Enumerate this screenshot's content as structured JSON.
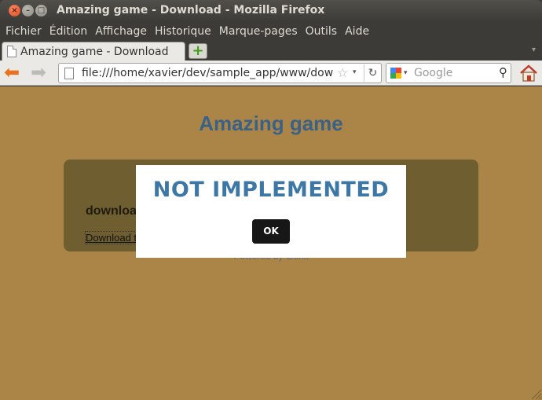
{
  "window": {
    "title": "Amazing game - Download - Mozilla Firefox",
    "close_glyph": "×",
    "minimize_glyph": "–",
    "maximize_glyph": "□"
  },
  "menu": [
    "Fichier",
    "Édition",
    "Affichage",
    "Historique",
    "Marque-pages",
    "Outils",
    "Aide"
  ],
  "tabs": [
    {
      "label": "Amazing game - Download"
    }
  ],
  "toolbar": {
    "new_tab_glyph": "+",
    "back_glyph": "⬅",
    "forward_glyph": "➡",
    "url": "file:///home/xavier/dev/sample_app/www/download.html",
    "bookmark_star": "☆",
    "dropdown_glyph": "▾",
    "reload_glyph": "↻",
    "search_placeholder": "Google",
    "search_glyph": "⚲"
  },
  "page": {
    "title": "Amazing game",
    "heading": "download",
    "link": "Download the",
    "footer": "Powered by Gerik"
  },
  "modal": {
    "message": "NOT IMPLEMENTED",
    "ok_label": "OK"
  },
  "colors": {
    "page_background": "#ab8547",
    "panel": "#6f5f30",
    "title": "#3a6186",
    "modal_text": "#3d77a6"
  }
}
